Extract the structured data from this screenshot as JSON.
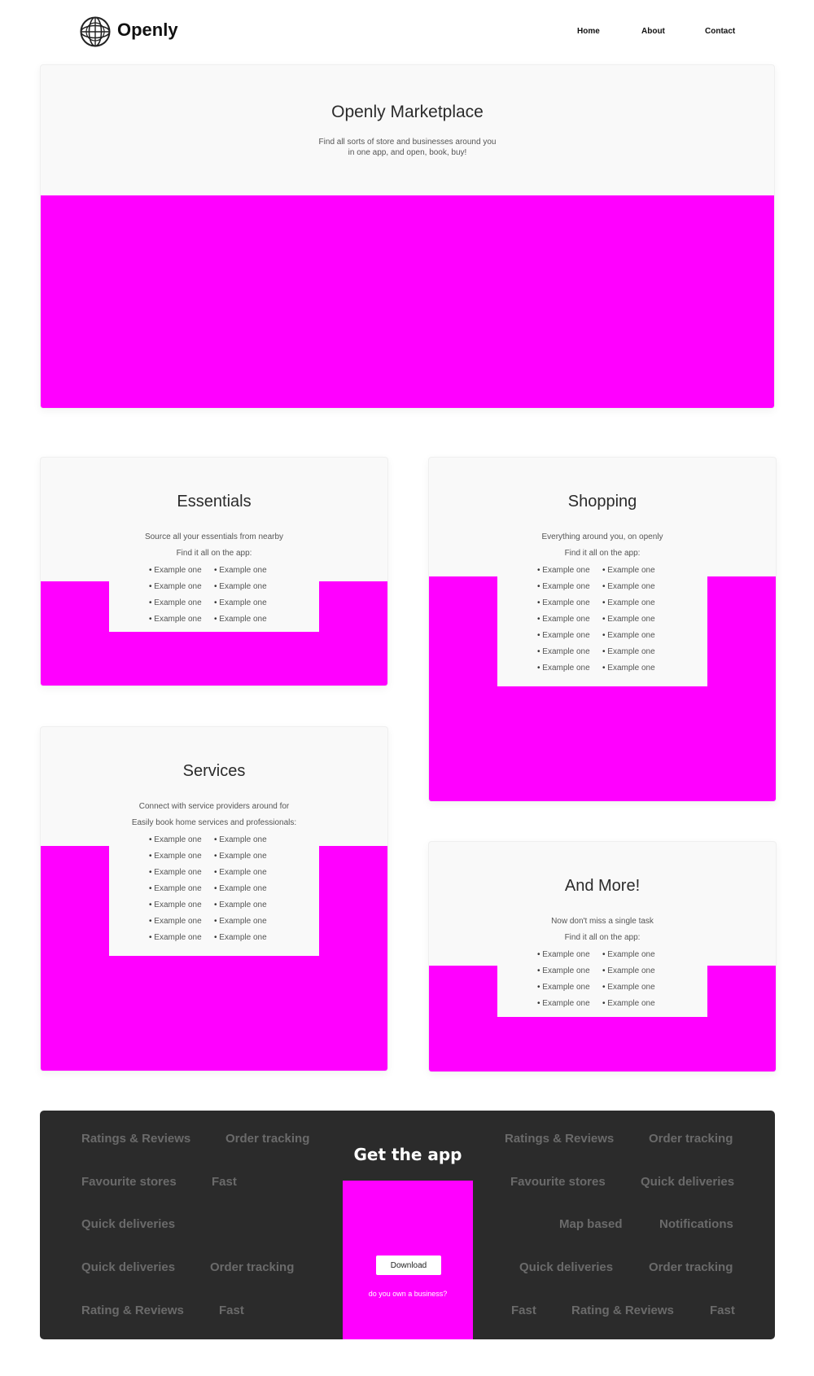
{
  "nav": {
    "brand": "Openly",
    "logo_icon": "globe-icon",
    "links": [
      "Home",
      "About",
      "Contact"
    ]
  },
  "hero": {
    "title": "Openly Marketplace",
    "subtitle": "Find all sorts of store and businesses around you in one app, and open, book, buy!"
  },
  "cards": {
    "essentials": {
      "title": "Essentials",
      "line1": "Source all your essentials from nearby",
      "line2": "Find it all on the app:",
      "items": [
        "Example one",
        "Example one",
        "Example one",
        "Example one",
        "Example one",
        "Example one",
        "Example one",
        "Example one"
      ]
    },
    "shopping": {
      "title": "Shopping",
      "line1": "Everything around you, on openly",
      "line2": "Find it all on the app:",
      "items": [
        "Example one",
        "Example one",
        "Example one",
        "Example one",
        "Example one",
        "Example one",
        "Example one",
        "Example one",
        "Example one",
        "Example one",
        "Example one",
        "Example one",
        "Example one",
        "Example one"
      ]
    },
    "services": {
      "title": "Services",
      "line1": "Connect with service providers around for",
      "line2": "Easily book home services and professionals:",
      "items": [
        "Example one",
        "Example one",
        "Example one",
        "Example one",
        "Example one",
        "Example one",
        "Example one",
        "Example one",
        "Example one",
        "Example one",
        "Example one",
        "Example one",
        "Example one",
        "Example one"
      ]
    },
    "more": {
      "title": "And More!",
      "line1": "Now don't miss a single task",
      "line2": "Find it all on the app:",
      "items": [
        "Example one",
        "Example one",
        "Example one",
        "Example one",
        "Example one",
        "Example one",
        "Example one",
        "Example one"
      ]
    }
  },
  "footer": {
    "title": "Get the app",
    "download_label": "Download",
    "business_link": "do you own a business?",
    "left_features": [
      "Ratings & Reviews",
      "Order tracking",
      "Favourite stores",
      "Fast",
      "Quick deliveries",
      "Quick deliveries",
      "Order tracking",
      "Rating & Reviews",
      "Fast"
    ],
    "right_features": [
      "Ratings & Reviews",
      "Order tracking",
      "Favourite stores",
      "Quick deliveries",
      "Map based",
      "Notifications",
      "Quick deliveries",
      "Order tracking",
      "Fast",
      "Rating & Reviews",
      "Fast"
    ]
  },
  "colors": {
    "placeholder": "#ff00ff",
    "card_bg": "#f9f9f9",
    "footer_bg": "#2b2b2b",
    "feature_text": "#6a6a6a"
  }
}
